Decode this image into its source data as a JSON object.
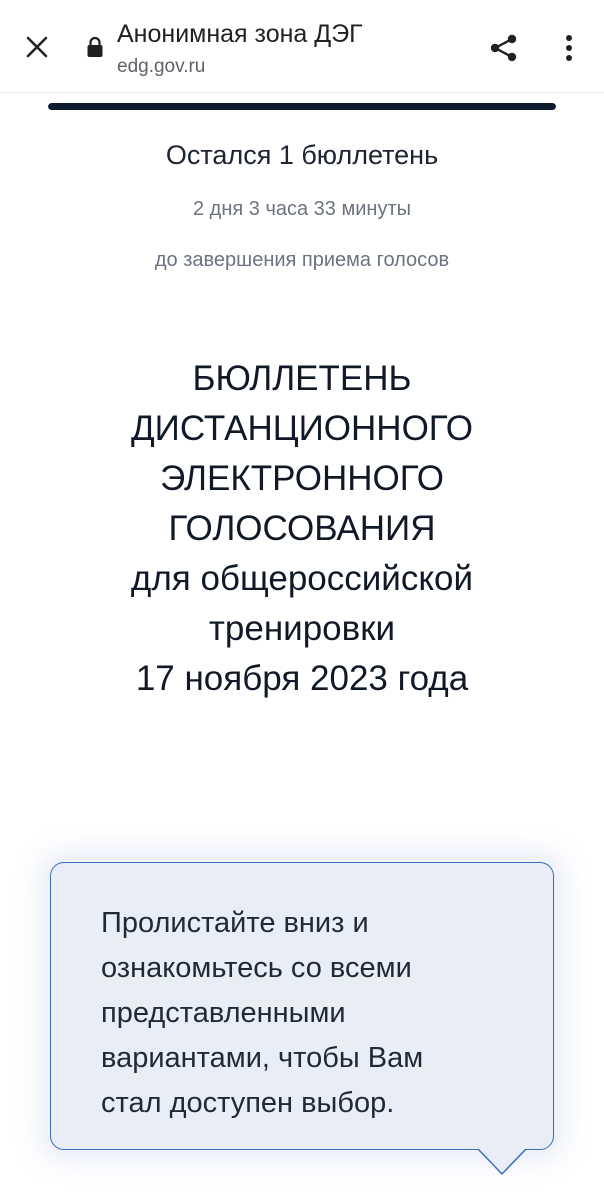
{
  "browser": {
    "title": "Анонимная зона ДЭГ",
    "url": "edg.gov.ru",
    "icons": {
      "close": "close-icon",
      "lock": "lock-icon",
      "share": "share-icon",
      "more": "more-vert-icon"
    }
  },
  "progress": {
    "fraction": 0.0
  },
  "status": {
    "ballots_left": "Остался 1 бюллетень",
    "time_left": "2 дня 3 часа 33 минуты",
    "deadline_note": "до завершения приема голосов"
  },
  "ballot": {
    "lines": [
      "БЮЛЛЕТЕНЬ",
      "ДИСТАНЦИОННОГО",
      "ЭЛЕКТРОННОГО",
      "ГОЛОСОВАНИЯ",
      "для общероссийской",
      "тренировки",
      "17 ноября 2023 года"
    ]
  },
  "tooltip": {
    "lines": [
      "Пролистайте вниз и",
      "ознакомьтесь со всеми",
      "представленными",
      "вариантами, чтобы Вам",
      "стал доступен выбор."
    ]
  },
  "colors": {
    "accent_dark": "#0d1b2e",
    "tooltip_bg": "#e8edf6",
    "tooltip_border": "#3b6fb6",
    "muted_text": "#6b7280"
  }
}
